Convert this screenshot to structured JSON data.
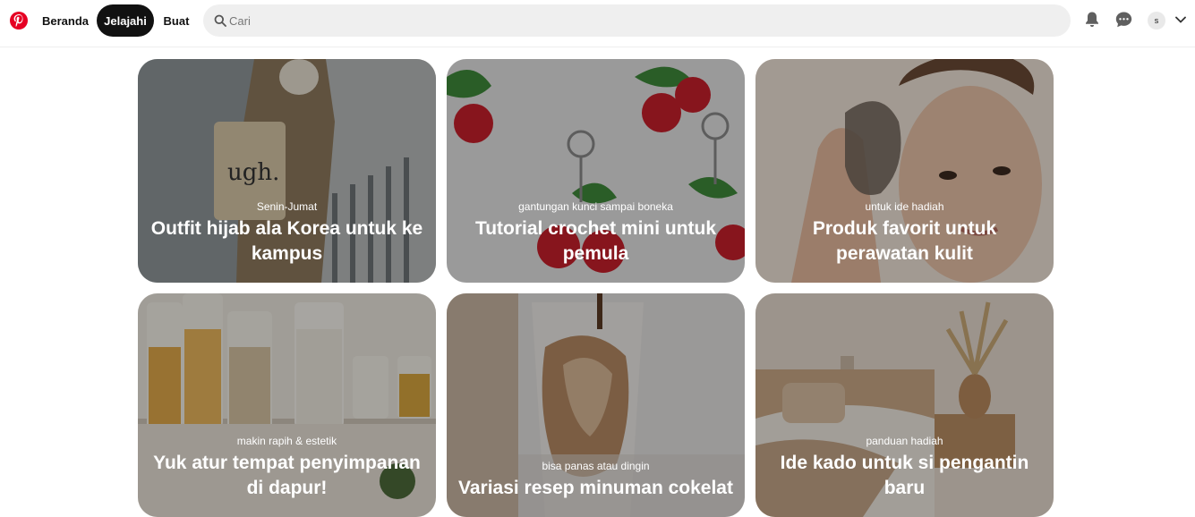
{
  "header": {
    "nav": {
      "home": "Beranda",
      "explore": "Jelajahi",
      "create": "Buat"
    },
    "search": {
      "placeholder": "Cari"
    },
    "avatar_initial": "s"
  },
  "cards": [
    {
      "subtitle": "Senin-Jumat",
      "title": "Outfit hijab ala Korea untuk ke kampus"
    },
    {
      "subtitle": "gantungan kunci sampai boneka",
      "title": "Tutorial crochet mini untuk pemula"
    },
    {
      "subtitle": "untuk ide hadiah",
      "title": "Produk favorit untuk perawatan kulit"
    },
    {
      "subtitle": "makin rapih & estetik",
      "title": "Yuk atur tempat penyimpanan di dapur!"
    },
    {
      "subtitle": "bisa panas atau dingin",
      "title": "Variasi resep minuman cokelat"
    },
    {
      "subtitle": "panduan hadiah",
      "title": "Ide kado untuk si pengantin baru"
    }
  ],
  "colors": {
    "brand": "#e60023",
    "active_tab_bg": "#111111",
    "search_bg": "#efefef"
  },
  "icons": [
    "pinterest-logo-icon",
    "search-icon",
    "bell-icon",
    "chat-icon",
    "chevron-down-icon"
  ]
}
